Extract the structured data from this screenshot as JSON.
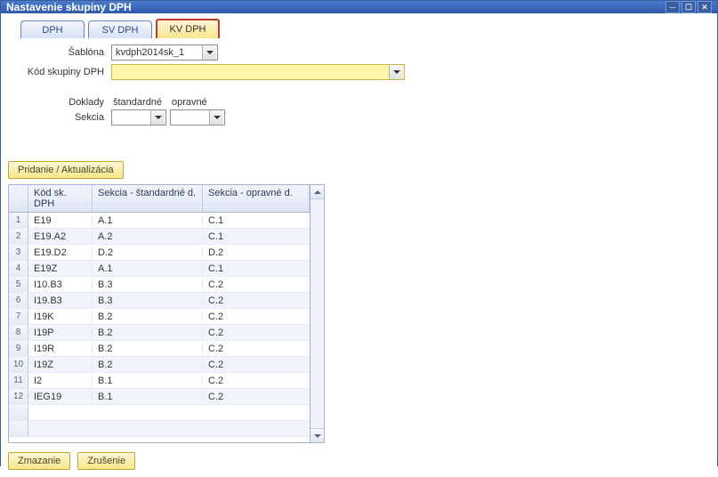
{
  "window": {
    "title": "Nastavenie skupiny DPH"
  },
  "tabs": [
    {
      "label": "DPH"
    },
    {
      "label": "SV DPH"
    },
    {
      "label": "KV DPH"
    }
  ],
  "form": {
    "sablona_label": "Šablóna",
    "sablona_value": "kvdph2014sk_1",
    "kod_sk_label": "Kód skupiny DPH",
    "kod_sk_value": ""
  },
  "doklady": {
    "label": "Doklady",
    "standardne_label": "štandardné",
    "opravne_label": "opravné",
    "sekcia_label": "Sekcia",
    "standardne_value": "",
    "opravne_value": ""
  },
  "buttons": {
    "add_update": "Pridanie / Aktualizácia",
    "delete": "Zmazanie",
    "cancel": "Zrušenie"
  },
  "grid": {
    "headers": {
      "num": "",
      "kod": "Kód sk. DPH",
      "std": "Sekcia - štandardné d.",
      "opr": "Sekcia - opravné d."
    },
    "rows": [
      {
        "kod": "E19",
        "std": "A.1",
        "opr": "C.1"
      },
      {
        "kod": "E19.A2",
        "std": "A.2",
        "opr": "C.1"
      },
      {
        "kod": "E19.D2",
        "std": "D.2",
        "opr": "D.2"
      },
      {
        "kod": "E19Z",
        "std": "A.1",
        "opr": "C.1"
      },
      {
        "kod": "I10.B3",
        "std": "B.3",
        "opr": "C.2"
      },
      {
        "kod": "I19.B3",
        "std": "B.3",
        "opr": "C.2"
      },
      {
        "kod": "I19K",
        "std": "B.2",
        "opr": "C.2"
      },
      {
        "kod": "I19P",
        "std": "B.2",
        "opr": "C.2"
      },
      {
        "kod": "I19R",
        "std": "B.2",
        "opr": "C.2"
      },
      {
        "kod": "I19Z",
        "std": "B.2",
        "opr": "C.2"
      },
      {
        "kod": "I2",
        "std": "B.1",
        "opr": "C.2"
      },
      {
        "kod": "IEG19",
        "std": "B.1",
        "opr": "C.2"
      }
    ],
    "empty_rows_after": 2
  }
}
